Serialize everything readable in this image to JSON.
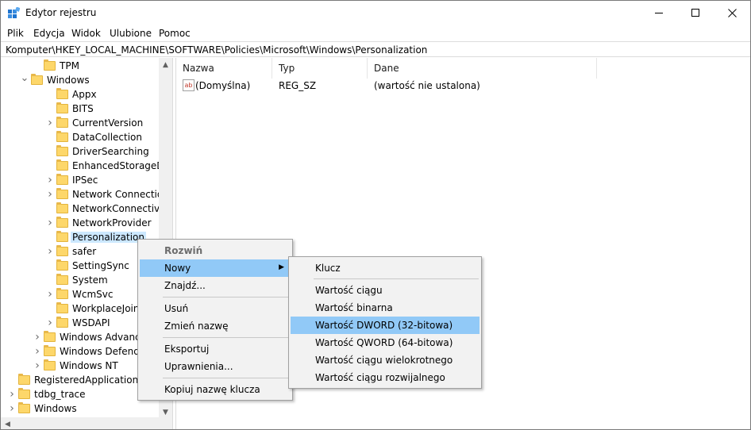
{
  "window": {
    "title": "Edytor rejestru",
    "controls": [
      "minimize-icon",
      "maximize-icon",
      "close-icon"
    ]
  },
  "menubar": [
    "Plik",
    "Edycja",
    "Widok",
    "Ulubione",
    "Pomoc"
  ],
  "address": "Komputer\\HKEY_LOCAL_MACHINE\\SOFTWARE\\Policies\\Microsoft\\Windows\\Personalization",
  "tree": [
    {
      "label": "TPM",
      "chevron": ""
    },
    {
      "label": "Windows",
      "chevron": "expanded"
    },
    {
      "label": "Appx",
      "chevron": ""
    },
    {
      "label": "BITS",
      "chevron": ""
    },
    {
      "label": "CurrentVersion",
      "chevron": "collapsed"
    },
    {
      "label": "DataCollection",
      "chevron": ""
    },
    {
      "label": "DriverSearching",
      "chevron": ""
    },
    {
      "label": "EnhancedStorageDe",
      "chevron": ""
    },
    {
      "label": "IPSec",
      "chevron": "collapsed"
    },
    {
      "label": "Network Connection",
      "chevron": "collapsed"
    },
    {
      "label": "NetworkConnectivit",
      "chevron": ""
    },
    {
      "label": "NetworkProvider",
      "chevron": "collapsed"
    },
    {
      "label": "Personalization",
      "chevron": "",
      "selected": true
    },
    {
      "label": "safer",
      "chevron": "collapsed"
    },
    {
      "label": "SettingSync",
      "chevron": ""
    },
    {
      "label": "System",
      "chevron": ""
    },
    {
      "label": "WcmSvc",
      "chevron": "collapsed"
    },
    {
      "label": "WorkplaceJoin",
      "chevron": ""
    },
    {
      "label": "WSDAPI",
      "chevron": "collapsed"
    },
    {
      "label": "Windows Advance",
      "chevron": "collapsed"
    },
    {
      "label": "Windows Defende",
      "chevron": "collapsed"
    },
    {
      "label": "Windows NT",
      "chevron": "collapsed"
    },
    {
      "label": "RegisteredApplications",
      "chevron": ""
    },
    {
      "label": "tdbg_trace",
      "chevron": "collapsed"
    },
    {
      "label": "Windows",
      "chevron": "collapsed"
    }
  ],
  "list": {
    "columns": [
      "Nazwa",
      "Typ",
      "Dane"
    ],
    "rows": [
      {
        "name": "(Domyślna)",
        "type": "REG_SZ",
        "data": "(wartość nie ustalona)",
        "icon": "string-value-icon"
      }
    ],
    "icon_glyph": "ab"
  },
  "context_menu": {
    "items": [
      {
        "label": "Rozwiń",
        "kind": "header"
      },
      {
        "label": "Nowy",
        "kind": "submenu",
        "highlighted": true
      },
      {
        "label": "Znajdź...",
        "kind": "item"
      },
      {
        "label": "Usuń",
        "kind": "item"
      },
      {
        "label": "Zmień nazwę",
        "kind": "item"
      },
      {
        "label": "Eksportuj",
        "kind": "item"
      },
      {
        "label": "Uprawnienia...",
        "kind": "item"
      },
      {
        "label": "Kopiuj nazwę klucza",
        "kind": "item"
      }
    ]
  },
  "submenu": {
    "items": [
      {
        "label": "Klucz"
      },
      {
        "label": "Wartość ciągu"
      },
      {
        "label": "Wartość binarna"
      },
      {
        "label": "Wartość DWORD (32-bitowa)",
        "highlighted": true
      },
      {
        "label": "Wartość QWORD (64-bitowa)"
      },
      {
        "label": "Wartość ciągu wielokrotnego"
      },
      {
        "label": "Wartość ciągu rozwijalnego"
      }
    ]
  },
  "colors": {
    "highlight": "#91c9f7",
    "selection": "#cce8ff",
    "folder": "#fdd76a"
  }
}
